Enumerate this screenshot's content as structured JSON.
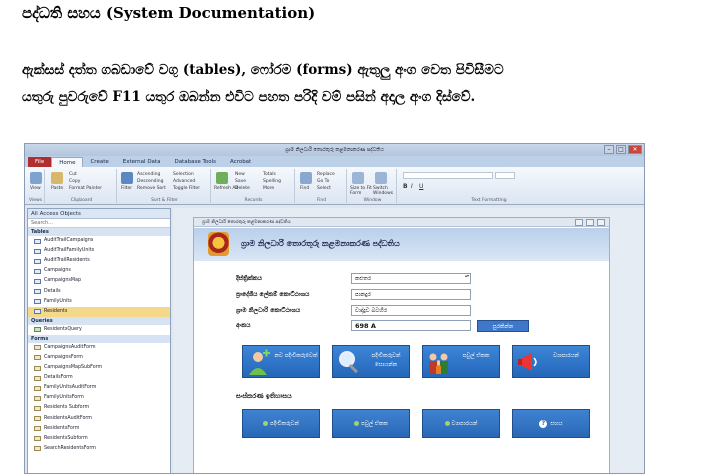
{
  "doc": {
    "heading": "පද්ධති සහය (System Documentation)",
    "para_line1": "ඇක්සස් දත්ත ගබඩාවේ වගු (tables), ෆෝරම (forms) ඇතුලු අංග වෙත පිවිසීමට",
    "para_line2": "යතුරු පුවරුවේ F11 යතුර ඔබන්න එවිට පහත පරිදි වම් පසින් අදාල අංග දිස්වේ."
  },
  "window": {
    "title": "ග්‍රාම නිලධාරි තොරතුරු කළමනාකරණ පද්ධතිය"
  },
  "ribbon": {
    "tabs": [
      "File",
      "Home",
      "Create",
      "External Data",
      "Database Tools",
      "Acrobat"
    ],
    "active_tab": "Home",
    "groups": {
      "views": {
        "label": "Views",
        "items": [
          "View"
        ]
      },
      "clipboard": {
        "label": "Clipboard",
        "items": [
          "Paste",
          "Cut",
          "Copy",
          "Format Painter"
        ]
      },
      "sort": {
        "label": "Sort & Filter",
        "items": [
          "Filter",
          "Ascending",
          "Descending",
          "Remove Sort",
          "Selection",
          "Advanced",
          "Toggle Filter"
        ]
      },
      "records": {
        "label": "Records",
        "items": [
          "Refresh All",
          "New",
          "Save",
          "Delete",
          "Totals",
          "Spelling",
          "More"
        ]
      },
      "find": {
        "label": "Find",
        "items": [
          "Find",
          "Replace",
          "Go To",
          "Select"
        ]
      },
      "window": {
        "label": "Window",
        "items": [
          "Size to Fit Form",
          "Switch Windows"
        ]
      },
      "text": {
        "label": "Text Formatting",
        "items": [
          "B",
          "I",
          "U"
        ]
      }
    }
  },
  "nav": {
    "header": "All Access Objects",
    "search_placeholder": "Search...",
    "sections": [
      {
        "label": "Tables",
        "kind": "t",
        "items": [
          "AuditTrailCampaigns",
          "AuditTrailFamilyUnits",
          "AuditTrailResidents",
          "Campaigns",
          "CampaignsMap",
          "Details",
          "FamilyUnits",
          "Residents"
        ],
        "selected": "Residents"
      },
      {
        "label": "Queries",
        "kind": "q",
        "items": [
          "ResidentsQuery"
        ]
      },
      {
        "label": "Forms",
        "kind": "f",
        "items": [
          "CampaignsAuditForm",
          "CampaignsForm",
          "CampaignsMapSubForm",
          "DetailsForm",
          "FamilyUnitsAuditForm",
          "FamilyUnitsForm",
          "Residents Subform",
          "ResidentsAuditForm",
          "ResidentsForm",
          "ResidentsSubform",
          "SearchResidentsForm"
        ]
      }
    ]
  },
  "form": {
    "tab_title": "ග්‍රාම නිලධාරි තොරතුරු කළමනාකරණ පද්ධතිය",
    "title": "ග්‍රාම නිලධාරි තොරතුරු කළමනාකරණ පද්ධතිය",
    "fields": [
      {
        "label": "දිස්ත්‍රික්කය",
        "value": "කළුතර"
      },
      {
        "label": "ප්‍රාදේශීය ලේකම් කොට්ඨාශය",
        "value": "පානදුර"
      },
      {
        "label": "ග්‍රාම නිලධාරි කොට්ඨාශය",
        "value": "වාද්දුව බටහිර"
      },
      {
        "label": "අංකය",
        "value": "698 A"
      }
    ],
    "save_button": "සුරකින්න",
    "tiles": [
      {
        "label": "නව පදිංචිකරුවෙක්",
        "icon": "add-person-icon"
      },
      {
        "label": "පදිංචිකරුවන් සොයන්න",
        "icon": "magnifier-icon"
      },
      {
        "label": "පවුල් ඒකක",
        "icon": "family-icon"
      },
      {
        "label": "ව්‍යාපාරයන්",
        "icon": "megaphone-icon"
      }
    ],
    "history_heading": "සංස්කරණ ඉතිහාසය",
    "history_buttons": [
      {
        "label": "පදිංචිකරුවන්"
      },
      {
        "label": "පවුල් ඒකක"
      },
      {
        "label": "ව්‍යාපාරයන්"
      },
      {
        "label": "සහය"
      }
    ]
  }
}
